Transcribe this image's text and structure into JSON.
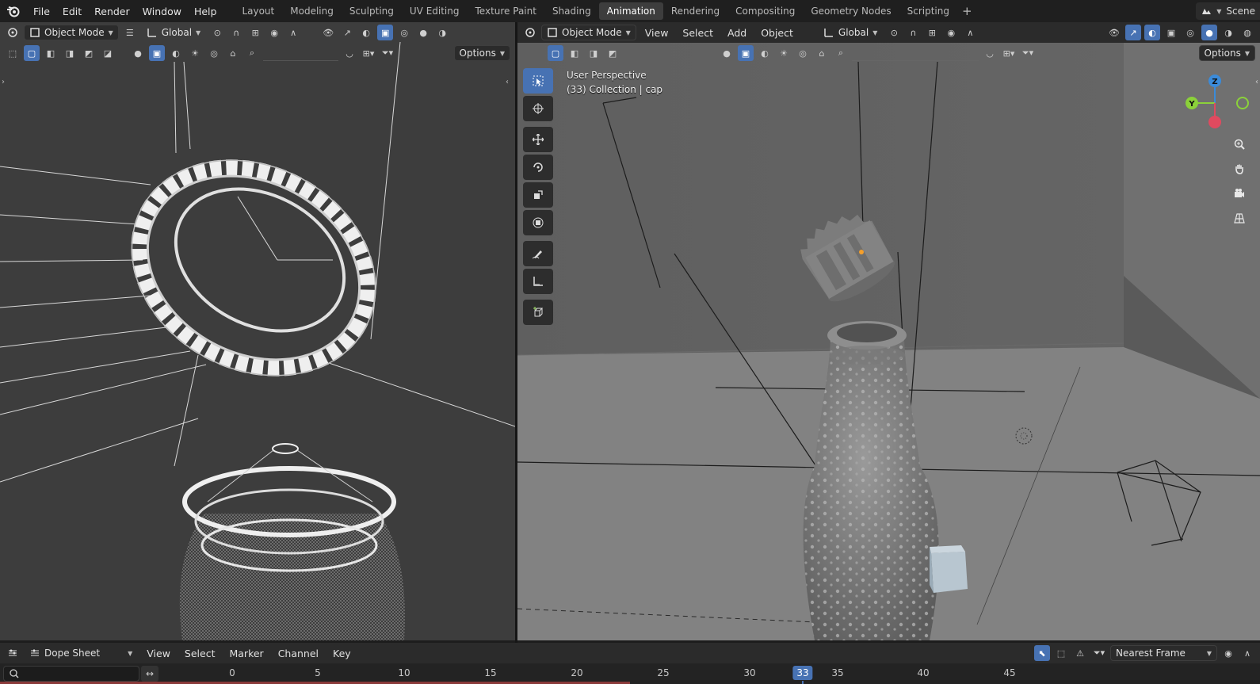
{
  "menus": [
    "File",
    "Edit",
    "Render",
    "Window",
    "Help"
  ],
  "workspaces": [
    "Layout",
    "Modeling",
    "Sculpting",
    "UV Editing",
    "Texture Paint",
    "Shading",
    "Animation",
    "Rendering",
    "Compositing",
    "Geometry Nodes",
    "Scripting"
  ],
  "active_workspace": "Animation",
  "scene_label": "Scene",
  "left_view": {
    "mode": "Object Mode",
    "orientation": "Global",
    "options_label": "Options"
  },
  "right_view": {
    "mode": "Object Mode",
    "menus": [
      "View",
      "Select",
      "Add",
      "Object"
    ],
    "orientation": "Global",
    "options_label": "Options",
    "info_line1": "User Perspective",
    "info_line2": "(33) Collection | cap"
  },
  "gizmo": {
    "x_color": "#e04a5f",
    "y_color": "#8bd13a",
    "z_color": "#3b8bd9",
    "z_label": "Z",
    "y_label": "Y"
  },
  "dope_sheet": {
    "editor_type": "Dope Sheet",
    "menus": [
      "View",
      "Select",
      "Marker",
      "Channel",
      "Key"
    ],
    "snap_mode": "Nearest Frame",
    "ticks": [
      "0",
      "5",
      "10",
      "15",
      "20",
      "25",
      "30",
      "35",
      "40",
      "45"
    ],
    "current_frame": "33"
  },
  "colors": {
    "accent": "#4772b3"
  }
}
